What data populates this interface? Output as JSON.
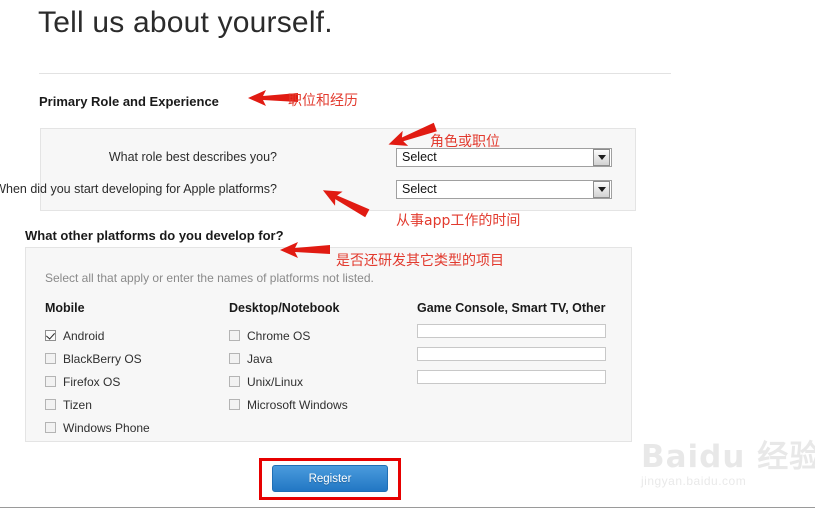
{
  "page": {
    "headline": "Tell us about yourself."
  },
  "primary_role_section": {
    "heading": "Primary Role and Experience",
    "fields": [
      {
        "label": "What role best describes you?",
        "value": "Select"
      },
      {
        "label": "When did you start developing for Apple platforms?",
        "value": "Select"
      }
    ]
  },
  "platforms_section": {
    "heading": "What other platforms do you develop for?",
    "hint": "Select all that apply or enter the names of platforms not listed.",
    "columns": [
      {
        "title": "Mobile",
        "type": "checkboxes",
        "items": [
          {
            "label": "Android",
            "checked": true
          },
          {
            "label": "BlackBerry OS",
            "checked": false
          },
          {
            "label": "Firefox OS",
            "checked": false
          },
          {
            "label": "Tizen",
            "checked": false
          },
          {
            "label": "Windows Phone",
            "checked": false
          }
        ]
      },
      {
        "title": "Desktop/Notebook",
        "type": "checkboxes",
        "items": [
          {
            "label": "Chrome OS",
            "checked": false
          },
          {
            "label": "Java",
            "checked": false
          },
          {
            "label": "Unix/Linux",
            "checked": false
          },
          {
            "label": "Microsoft Windows",
            "checked": false
          }
        ]
      },
      {
        "title": "Game Console, Smart TV, Other",
        "type": "textfields",
        "inputs": [
          {
            "value": "",
            "placeholder": ""
          },
          {
            "value": "",
            "placeholder": ""
          },
          {
            "value": "",
            "placeholder": ""
          }
        ]
      }
    ]
  },
  "footer": {
    "register_label": "Register"
  },
  "annotations": {
    "color": "#e23a2e",
    "notes": [
      {
        "text": "职位和经历"
      },
      {
        "text": "角色或职位"
      },
      {
        "text": "从事app工作的时间"
      },
      {
        "text": "是否还研发其它类型的项目"
      }
    ]
  },
  "watermark": {
    "main": "Baidu 经验",
    "sub": "jingyan.baidu.com"
  }
}
